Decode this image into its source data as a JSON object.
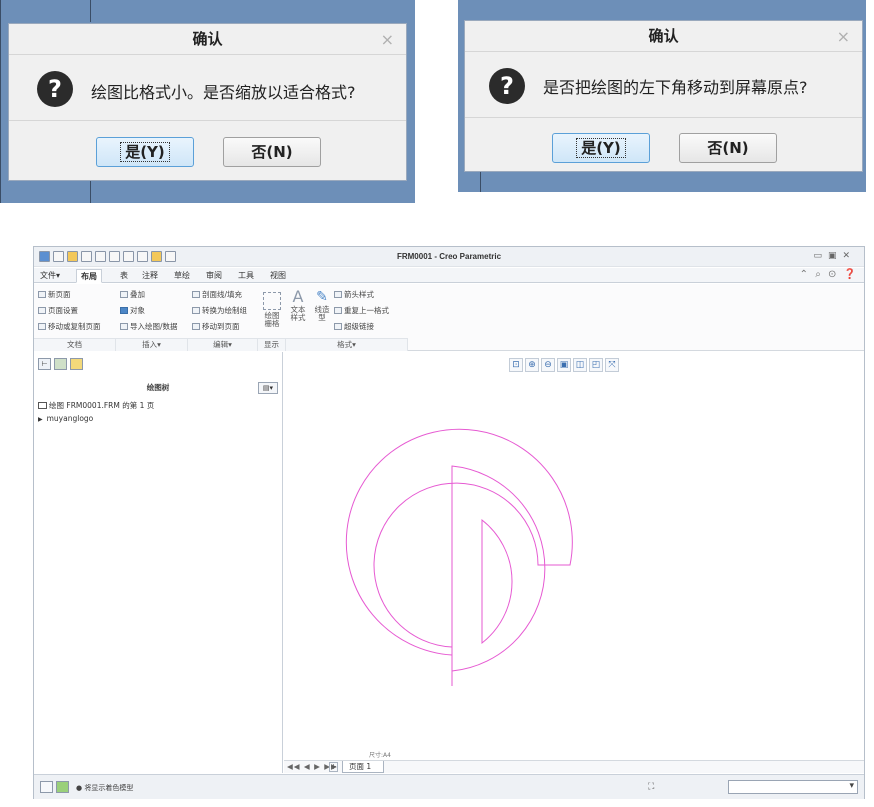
{
  "dialog1": {
    "title": "确认",
    "close": "×",
    "message": "绘图比格式小。是否缩放以适合格式?",
    "yes": "是(Y)",
    "no": "否(N)"
  },
  "dialog2": {
    "title": "确认",
    "close": "×",
    "message": "是否把绘图的左下角移动到屏幕原点?",
    "yes": "是(Y)",
    "no": "否(N)"
  },
  "app": {
    "title": "FRM0001 - Creo Parametric",
    "tabs": [
      "文件▾",
      "布局",
      "表",
      "注释",
      "草绘",
      "审阅",
      "工具",
      "视图"
    ],
    "active_tab": "布局",
    "ribbon": {
      "doc": [
        "新页面",
        "页面设置",
        "移动或复制页面"
      ],
      "insert": [
        "叠加",
        "对象",
        "导入绘图/数据"
      ],
      "edit": [
        "剖面线/填充",
        "转换为绘制组",
        "移动到页面"
      ],
      "display_big": "绘图\n栅格",
      "format_big1": "文本\n样式",
      "format_big2": "线造\n型",
      "format": [
        "箭头样式",
        "重复上一格式",
        "超级链接"
      ],
      "groups": [
        "文档",
        "插入▾",
        "编辑▾",
        "显示",
        "格式▾"
      ]
    },
    "tree": {
      "header": "绘图树",
      "items": [
        "绘图 FRM0001.FRM 的第 1 页",
        "muyanglogo"
      ]
    },
    "sheet_label": "尺寸:A4",
    "page_tab": "页面 1",
    "status_message": "将显示着色模型",
    "colors": {
      "drawing_line": "#e65ad2",
      "dialog_bg": "#6d8fb8"
    }
  }
}
